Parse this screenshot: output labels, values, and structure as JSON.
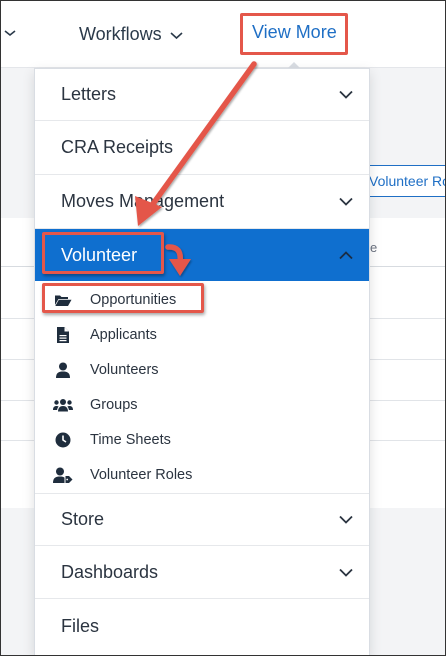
{
  "topnav": {
    "workflows_label": "Workflows",
    "view_more_label": "View More",
    "accent_color": "#1f6fc5"
  },
  "background": {
    "volunteer_roles_button": "Volunteer Roles",
    "column_label": "e"
  },
  "menu": {
    "sections": [
      {
        "label": "Letters",
        "expanded": false
      },
      {
        "label": "CRA Receipts",
        "expanded": false
      },
      {
        "label": "Moves Management",
        "expanded": false
      },
      {
        "label": "Volunteer",
        "expanded": true
      },
      {
        "label": "Store",
        "expanded": false
      },
      {
        "label": "Dashboards",
        "expanded": false
      },
      {
        "label": "Files",
        "expanded": false
      }
    ],
    "volunteer_items": [
      {
        "label": "Opportunities",
        "icon": "folder-open-icon"
      },
      {
        "label": "Applicants",
        "icon": "file-icon"
      },
      {
        "label": "Volunteers",
        "icon": "user-icon"
      },
      {
        "label": "Groups",
        "icon": "users-icon"
      },
      {
        "label": "Time Sheets",
        "icon": "clock-icon"
      },
      {
        "label": "Volunteer Roles",
        "icon": "user-tag-icon"
      }
    ],
    "active_color": "#0f6fcf"
  },
  "annotations": {
    "color": "#e4574a"
  }
}
